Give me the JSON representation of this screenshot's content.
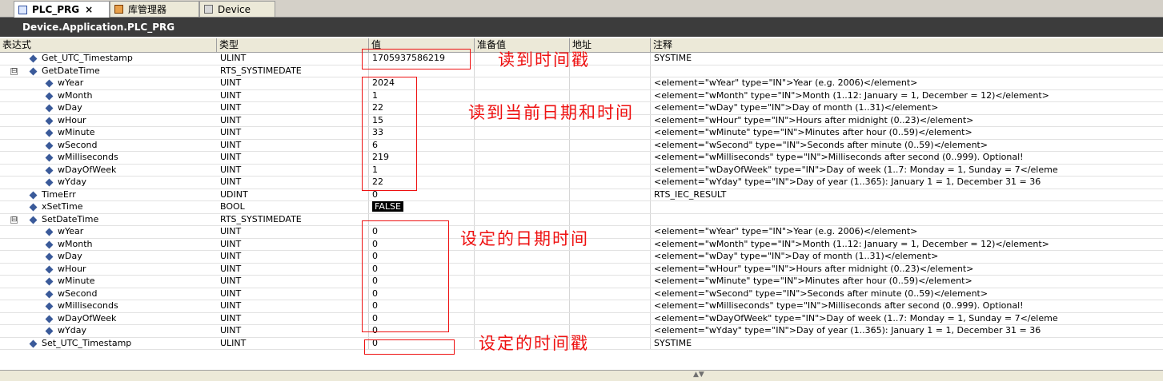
{
  "tabs": [
    {
      "label": "PLC_PRG",
      "icon": "program-icon",
      "active": true,
      "close": "×"
    },
    {
      "label": "库管理器",
      "icon": "library-manager-icon",
      "active": false
    },
    {
      "label": "Device",
      "icon": "device-icon",
      "active": false
    }
  ],
  "path_title": "Device.Application.PLC_PRG",
  "columns": {
    "expression": "表达式",
    "type": "类型",
    "value": "值",
    "prepared_value": "准备值",
    "address": "地址",
    "comment": "注释"
  },
  "rows": [
    {
      "name": "Get_UTC_Timestamp",
      "type": "ULINT",
      "value": "1705937586219",
      "comment": "SYSTIME"
    },
    {
      "name": "GetDateTime",
      "type": "RTS_SYSTIMEDATE",
      "value": "",
      "comment": "",
      "expander": "⊟"
    },
    {
      "name": "wYear",
      "type": "UINT",
      "value": "2024",
      "comment": "<element=\"wYear\" type=\"IN\">Year (e.g. 2006)</element>"
    },
    {
      "name": "wMonth",
      "type": "UINT",
      "value": "1",
      "comment": "<element=\"wMonth\" type=\"IN\">Month (1..12: January = 1, December = 12)</element>"
    },
    {
      "name": "wDay",
      "type": "UINT",
      "value": "22",
      "comment": "<element=\"wDay\" type=\"IN\">Day of month (1..31)</element>"
    },
    {
      "name": "wHour",
      "type": "UINT",
      "value": "15",
      "comment": "<element=\"wHour\" type=\"IN\">Hours after midnight (0..23)</element>"
    },
    {
      "name": "wMinute",
      "type": "UINT",
      "value": "33",
      "comment": "<element=\"wMinute\" type=\"IN\">Minutes after hour (0..59)</element>"
    },
    {
      "name": "wSecond",
      "type": "UINT",
      "value": "6",
      "comment": "<element=\"wSecond\" type=\"IN\">Seconds after minute (0..59)</element>"
    },
    {
      "name": "wMilliseconds",
      "type": "UINT",
      "value": "219",
      "comment": "<element=\"wMilliseconds\" type=\"IN\">Milliseconds after second (0..999). Optional!"
    },
    {
      "name": "wDayOfWeek",
      "type": "UINT",
      "value": "1",
      "comment": "<element=\"wDayOfWeek\" type=\"IN\">Day of week (1..7: Monday = 1, Sunday = 7</eleme"
    },
    {
      "name": "wYday",
      "type": "UINT",
      "value": "22",
      "comment": "<element=\"wYday\" type=\"IN\">Day of year (1..365): January 1 = 1, December 31 = 36"
    },
    {
      "name": "TimeErr",
      "type": "UDINT",
      "value": "0",
      "comment": "RTS_IEC_RESULT"
    },
    {
      "name": "xSetTime",
      "type": "BOOL",
      "value": "FALSE",
      "comment": ""
    },
    {
      "name": "SetDateTime",
      "type": "RTS_SYSTIMEDATE",
      "value": "",
      "comment": "",
      "expander": "⊟"
    },
    {
      "name": "wYear",
      "type": "UINT",
      "value": "0",
      "comment": "<element=\"wYear\" type=\"IN\">Year (e.g. 2006)</element>"
    },
    {
      "name": "wMonth",
      "type": "UINT",
      "value": "0",
      "comment": "<element=\"wMonth\" type=\"IN\">Month (1..12: January = 1, December = 12)</element>"
    },
    {
      "name": "wDay",
      "type": "UINT",
      "value": "0",
      "comment": "<element=\"wDay\" type=\"IN\">Day of month (1..31)</element>"
    },
    {
      "name": "wHour",
      "type": "UINT",
      "value": "0",
      "comment": "<element=\"wHour\" type=\"IN\">Hours after midnight (0..23)</element>"
    },
    {
      "name": "wMinute",
      "type": "UINT",
      "value": "0",
      "comment": "<element=\"wMinute\" type=\"IN\">Minutes after hour (0..59)</element>"
    },
    {
      "name": "wSecond",
      "type": "UINT",
      "value": "0",
      "comment": "<element=\"wSecond\" type=\"IN\">Seconds after minute (0..59)</element>"
    },
    {
      "name": "wMilliseconds",
      "type": "UINT",
      "value": "0",
      "comment": "<element=\"wMilliseconds\" type=\"IN\">Milliseconds after second (0..999). Optional!"
    },
    {
      "name": "wDayOfWeek",
      "type": "UINT",
      "value": "0",
      "comment": "<element=\"wDayOfWeek\" type=\"IN\">Day of week (1..7: Monday = 1, Sunday = 7</eleme"
    },
    {
      "name": "wYday",
      "type": "UINT",
      "value": "0",
      "comment": "<element=\"wYday\" type=\"IN\">Day of year (1..365): January 1 = 1, December 31 = 36"
    },
    {
      "name": "Set_UTC_Timestamp",
      "type": "ULINT",
      "value": "0",
      "comment": "SYSTIME"
    }
  ],
  "annotations": {
    "read_timestamp": "读到时间戳",
    "read_datetime": "读到当前日期和时间",
    "set_datetime": "设定的日期时间",
    "set_timestamp": "设定的时间戳"
  },
  "colors": {
    "annotation": "#ee1111",
    "path_bar": "#3c3c3c"
  }
}
